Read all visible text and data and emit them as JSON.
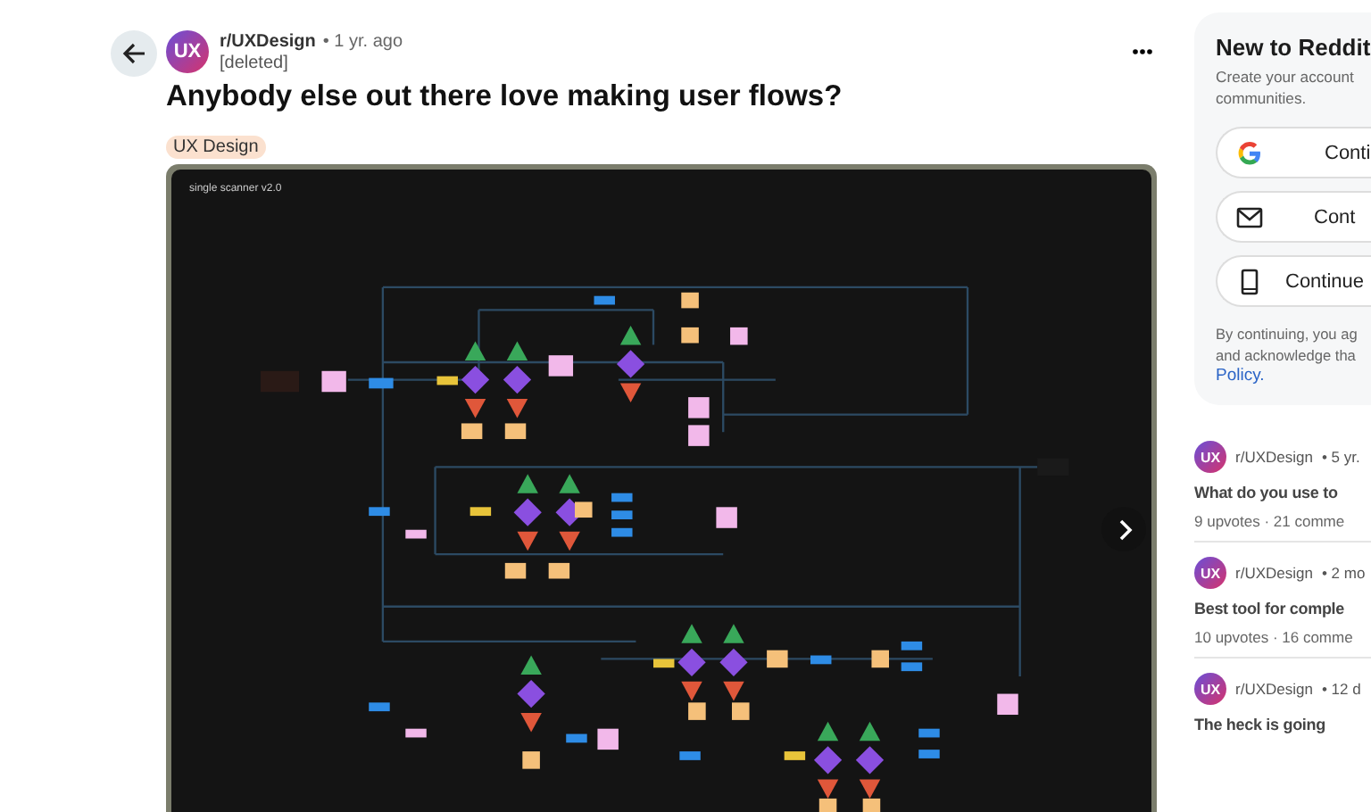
{
  "post": {
    "avatar_text": "UX",
    "subreddit": "r/UXDesign",
    "time": "• 1 yr. ago",
    "author": "[deleted]",
    "title": "Anybody else out there love making user flows?",
    "flair": "UX Design",
    "image": {
      "caption": "single scanner v2.0"
    }
  },
  "sidebar": {
    "signup": {
      "title": "New to Reddit",
      "subtitle_lines": [
        "Create your account",
        "communities."
      ],
      "buttons": [
        {
          "kind": "google",
          "label": "Conti"
        },
        {
          "kind": "email",
          "label": "Cont"
        },
        {
          "kind": "phone",
          "label": "Continue"
        }
      ],
      "legal_lines": [
        "By continuing, you ag",
        "and acknowledge tha"
      ],
      "legal_link": "Policy."
    },
    "related": [
      {
        "avatar_text": "UX",
        "subreddit": "r/UXDesign",
        "time": "• 5 yr.",
        "title": "What do you use to",
        "stats": "9 upvotes · 21 comme"
      },
      {
        "avatar_text": "UX",
        "subreddit": "r/UXDesign",
        "time": "• 2 mo",
        "title": "Best tool for comple",
        "stats": "10 upvotes · 16 comme"
      },
      {
        "avatar_text": "UX",
        "subreddit": "r/UXDesign",
        "time": "• 12 d",
        "title": "The heck is going"
      }
    ]
  }
}
